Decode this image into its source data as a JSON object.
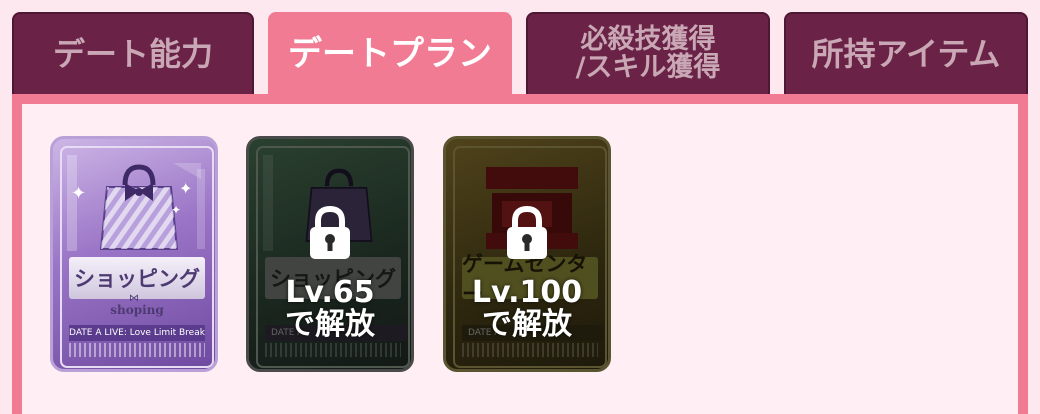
{
  "tabs": [
    {
      "label": "デート能力",
      "active": false
    },
    {
      "label": "デートプラン",
      "active": true
    },
    {
      "label_line1": "必殺技獲得",
      "label_line2": "/スキル獲得",
      "active": false
    },
    {
      "label": "所持アイテム",
      "active": false
    }
  ],
  "cards": [
    {
      "title": "ショッピング",
      "subtitle": "shoping",
      "footer": "DATE A LIVE: Love Limit Break",
      "locked": false,
      "icon": "shopping-bag-icon",
      "color": "#8a63b8"
    },
    {
      "title": "ショッピング",
      "footer": "DATE A",
      "locked": true,
      "unlock_level": "Lv.65",
      "unlock_text": "で解放",
      "icon": "shopping-bag-icon",
      "color": "#2f4a35"
    },
    {
      "title": "ゲームセンター",
      "footer": "DATE A",
      "locked": true,
      "unlock_level": "Lv.100",
      "unlock_text": "で解放",
      "icon": "arcade-machine-icon",
      "color": "#5a4a1e"
    }
  ],
  "colors": {
    "accent": "#f07b93",
    "tab_inactive": "#6a2347",
    "panel_bg": "#ffeef4"
  }
}
